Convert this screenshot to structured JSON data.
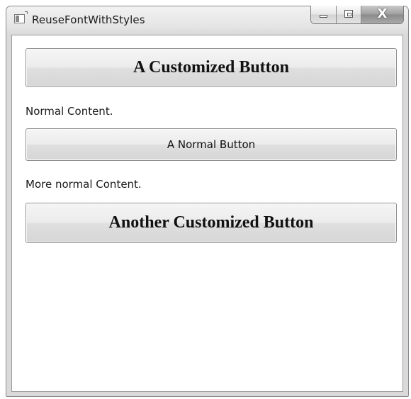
{
  "window": {
    "title": "ReuseFontWithStyles",
    "icon": "app-window-icon",
    "caption_buttons": {
      "minimize": "minimize-icon",
      "maximize": "maximize-icon",
      "close": "close-icon",
      "close_glyph": "X"
    }
  },
  "content": {
    "customized_button_1": "A Customized Button",
    "normal_label_1": "Normal Content.",
    "normal_button": "A Normal Button",
    "normal_label_2": "More normal Content.",
    "customized_button_2": "Another Customized Button"
  }
}
